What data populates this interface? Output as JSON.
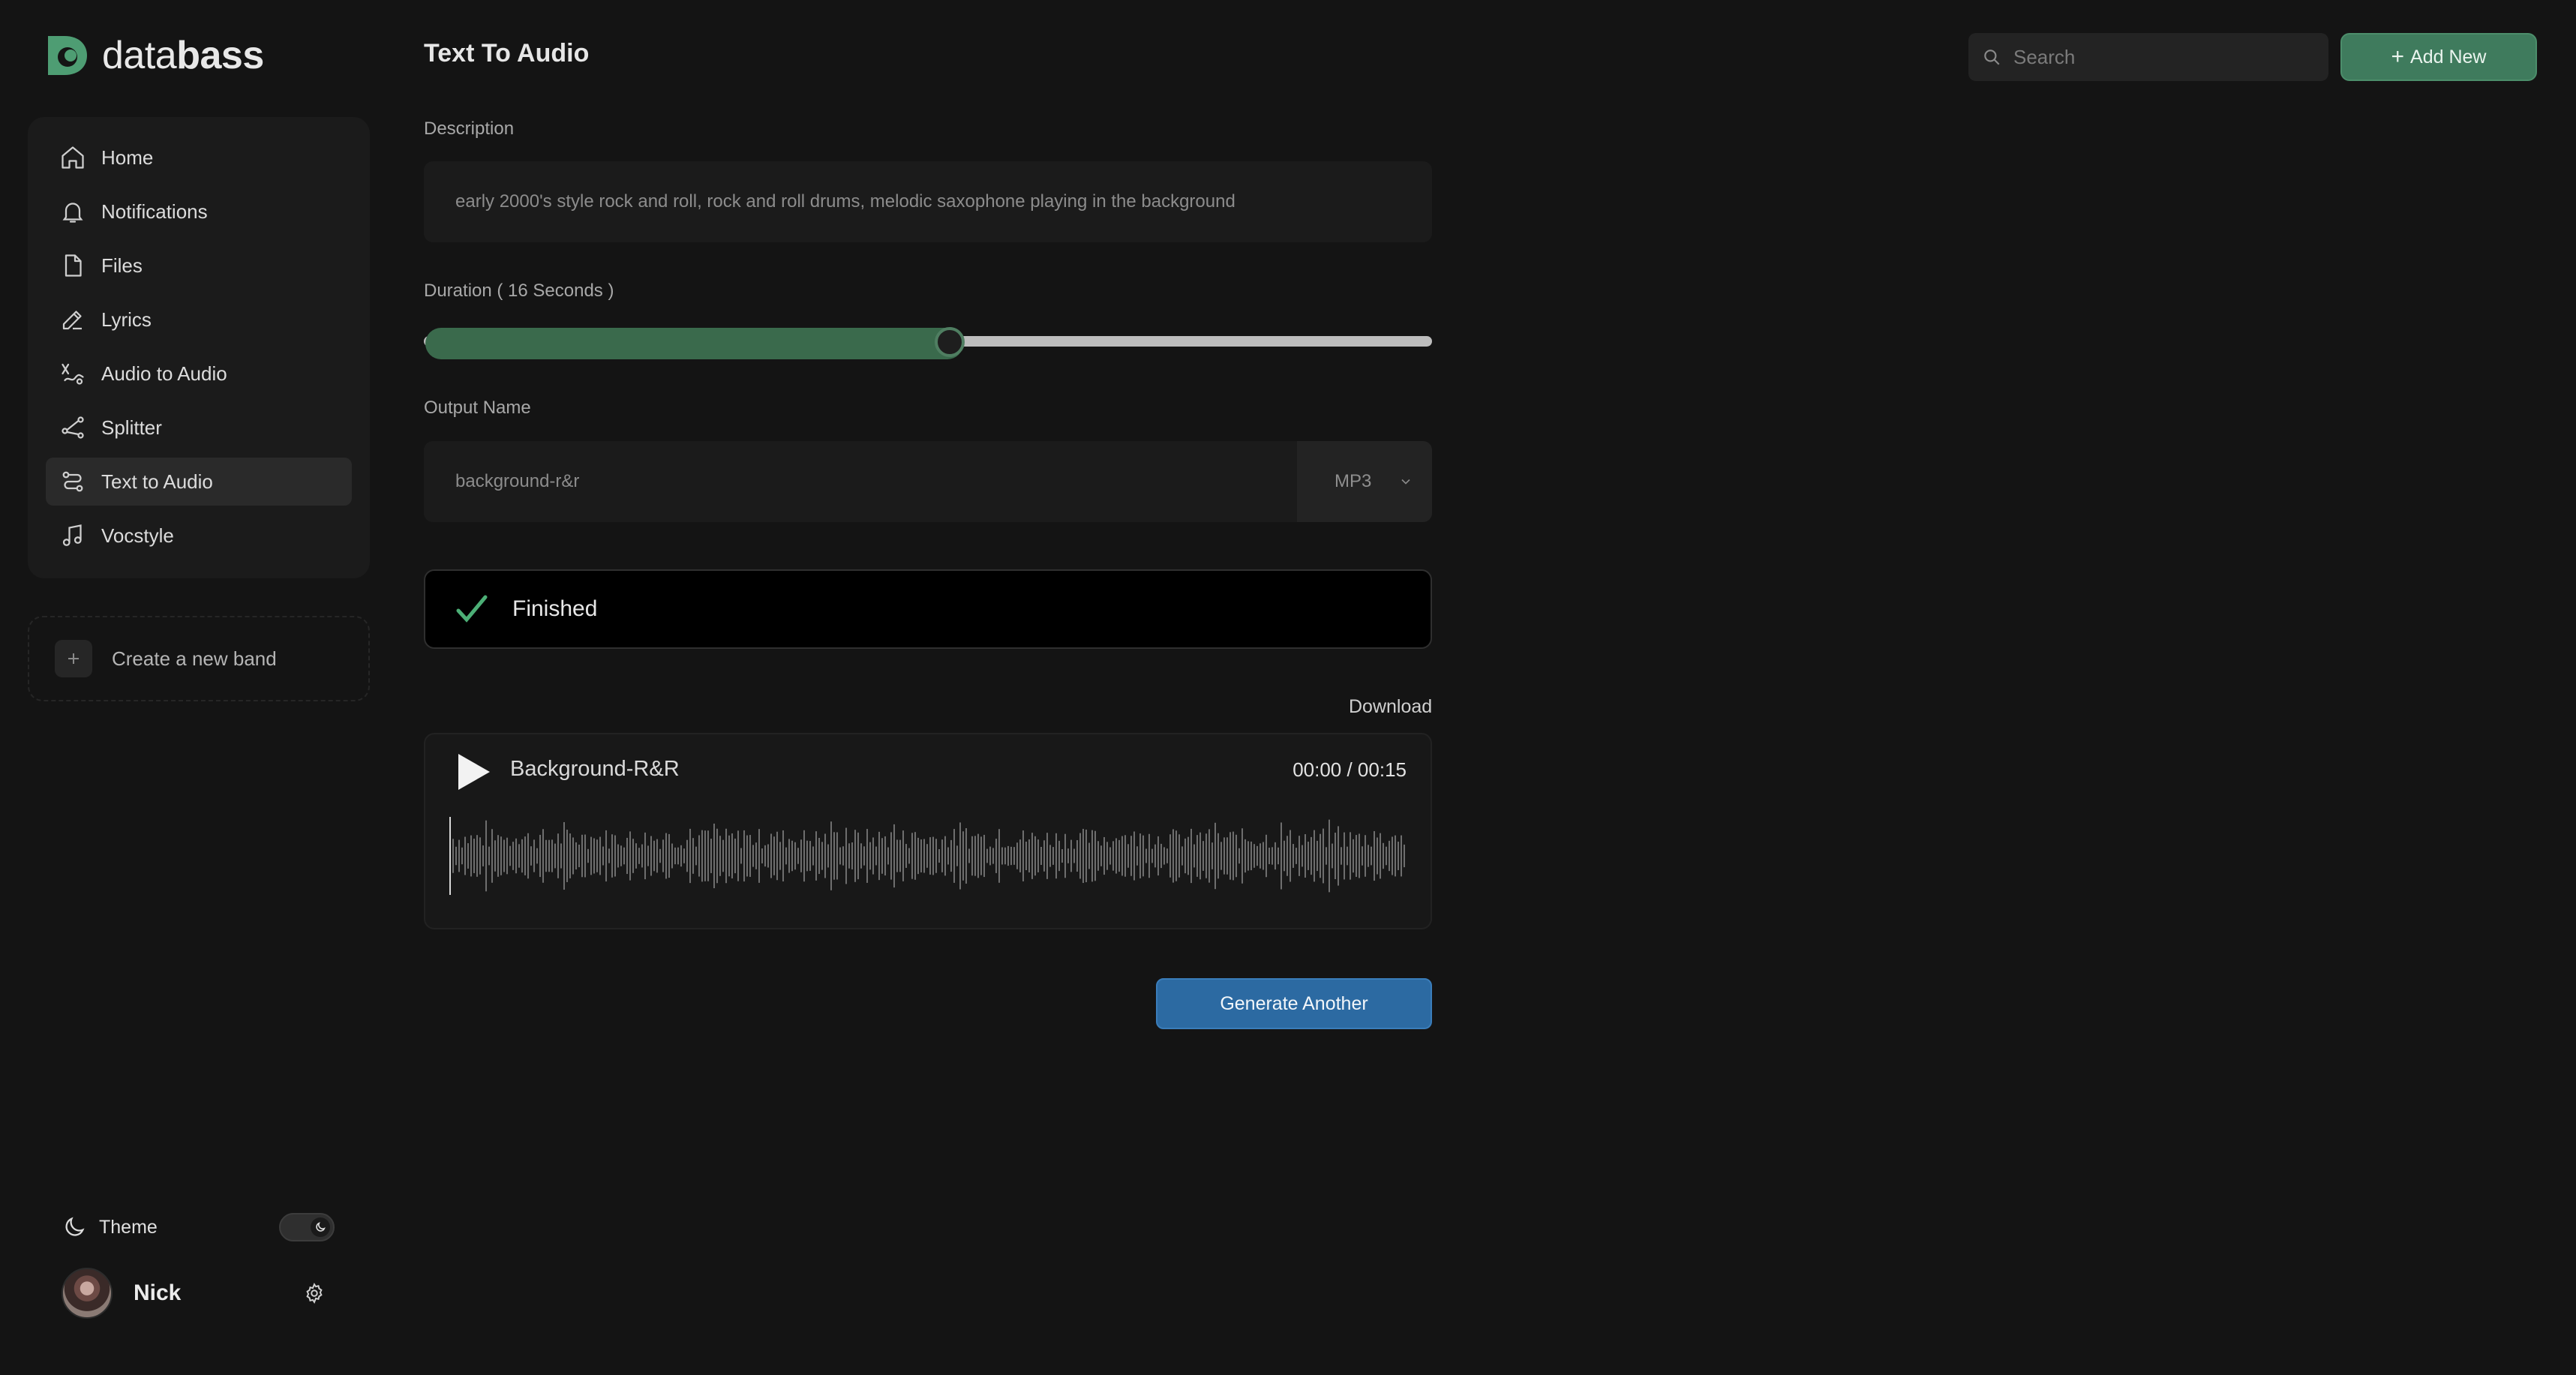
{
  "app": {
    "logo_text_light": "data",
    "logo_text_bold": "bass",
    "accent": "#3f7b5d",
    "logo_icon": "databass-logo-icon"
  },
  "sidebar": {
    "items": [
      {
        "label": "Home",
        "icon": "home-icon",
        "active": false
      },
      {
        "label": "Notifications",
        "icon": "bell-icon",
        "active": false
      },
      {
        "label": "Files",
        "icon": "file-icon",
        "active": false
      },
      {
        "label": "Lyrics",
        "icon": "pencil-icon",
        "active": false
      },
      {
        "label": "Audio to Audio",
        "icon": "audio-to-audio-icon",
        "active": false
      },
      {
        "label": "Splitter",
        "icon": "splitter-icon",
        "active": false
      },
      {
        "label": "Text to Audio",
        "icon": "route-icon",
        "active": true
      },
      {
        "label": "Vocstyle",
        "icon": "music-note-icon",
        "active": false
      }
    ],
    "create_band_label": "Create a new band",
    "theme_label": "Theme",
    "theme_mode": "dark",
    "user_name": "Nick"
  },
  "header": {
    "title": "Text To Audio",
    "search_placeholder": "Search",
    "add_new_label": "Add New"
  },
  "form": {
    "description_label": "Description",
    "description_value": "early 2000's style rock and roll, rock and roll drums, melodic saxophone playing in the background",
    "duration_label": "Duration ( 16 Seconds )",
    "duration_fraction": 0.52,
    "output_name_label": "Output Name",
    "output_name_value": "background-r&r",
    "format_value": "MP3"
  },
  "status": {
    "text": "Finished",
    "color": "#4caf76"
  },
  "player": {
    "download_label": "Download",
    "track_title": "Background-R&R",
    "time": "00:00 / 00:15"
  },
  "actions": {
    "generate_another_label": "Generate Another",
    "button_color": "#2c6aa2"
  }
}
